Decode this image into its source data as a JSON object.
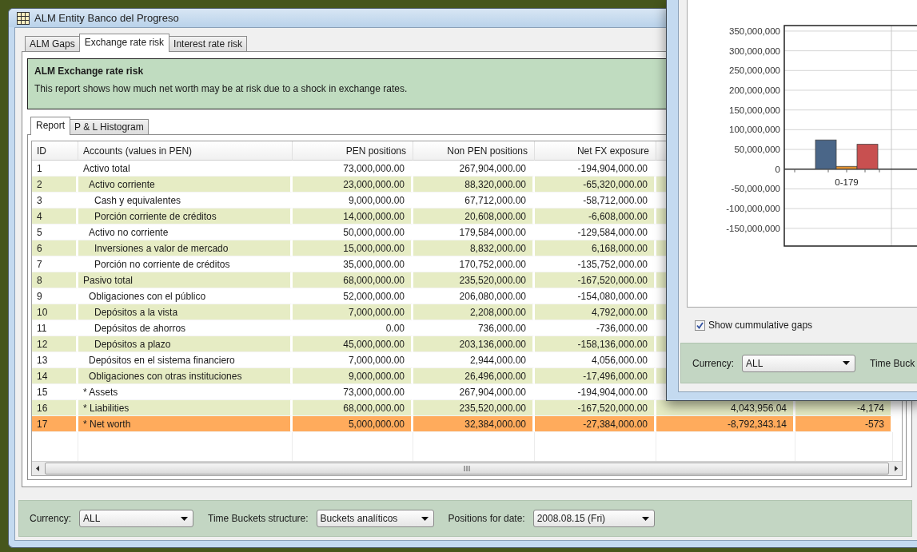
{
  "window": {
    "title": "ALM Entity Banco del Progreso"
  },
  "tabs": [
    {
      "label": "ALM Gaps",
      "selected": false
    },
    {
      "label": "Exchange rate risk",
      "selected": true
    },
    {
      "label": "Interest rate risk",
      "selected": false
    }
  ],
  "info": {
    "title": "ALM Exchange rate risk",
    "text": "This report shows how much net worth may be at risk due to a shock in exchange rates."
  },
  "sub_tabs": [
    {
      "label": "Report",
      "selected": true
    },
    {
      "label": "P & L Histogram",
      "selected": false
    }
  ],
  "table": {
    "columns": [
      "ID",
      "Accounts (values in PEN)",
      "PEN positions",
      "Non PEN positions",
      "Net FX exposure"
    ],
    "rows": [
      {
        "id": "1",
        "account": "Activo total",
        "pen": "73,000,000.00",
        "non_pen": "267,904,000.00",
        "net_fx": "-194,904,000.00",
        "highlighted": false,
        "children": [
          {
            "id": "2",
            "account": "Activo corriente",
            "pen": "23,000,000.00",
            "non_pen": "88,320,000.00",
            "net_fx": "-65,320,000.00",
            "highlighted": false,
            "children": [
              {
                "id": "3",
                "account": "Cash y equivalentes",
                "pen": "9,000,000.00",
                "non_pen": "67,712,000.00",
                "net_fx": "-58,712,000.00",
                "highlighted": false
              },
              {
                "id": "4",
                "account": "Porción corriente de créditos",
                "pen": "14,000,000.00",
                "non_pen": "20,608,000.00",
                "net_fx": "-6,608,000.00",
                "highlighted": false
              }
            ]
          },
          {
            "id": "5",
            "account": "Activo no corriente",
            "pen": "50,000,000.00",
            "non_pen": "179,584,000.00",
            "net_fx": "-129,584,000.00",
            "highlighted": false,
            "children": [
              {
                "id": "6",
                "account": "Inversiones a valor de mercado",
                "pen": "15,000,000.00",
                "non_pen": "8,832,000.00",
                "net_fx": "6,168,000.00",
                "highlighted": false
              },
              {
                "id": "7",
                "account": "Porción no corriente de créditos",
                "pen": "35,000,000.00",
                "non_pen": "170,752,000.00",
                "net_fx": "-135,752,000.00",
                "highlighted": false
              }
            ]
          }
        ]
      },
      {
        "id": "8",
        "account": "Pasivo total",
        "pen": "68,000,000.00",
        "non_pen": "235,520,000.00",
        "net_fx": "-167,520,000.00",
        "highlighted": false,
        "children": [
          {
            "id": "9",
            "account": "Obligaciones con el público",
            "pen": "52,000,000.00",
            "non_pen": "206,080,000.00",
            "net_fx": "-154,080,000.00",
            "highlighted": false,
            "children": [
              {
                "id": "10",
                "account": "Depósitos a la vista",
                "pen": "7,000,000.00",
                "non_pen": "2,208,000.00",
                "net_fx": "4,792,000.00",
                "highlighted": false
              },
              {
                "id": "11",
                "account": "Depósitos de ahorros",
                "pen": "0.00",
                "non_pen": "736,000.00",
                "net_fx": "-736,000.00",
                "highlighted": false
              },
              {
                "id": "12",
                "account": "Depósitos a plazo",
                "pen": "45,000,000.00",
                "non_pen": "203,136,000.00",
                "net_fx": "-158,136,000.00",
                "highlighted": false
              }
            ]
          },
          {
            "id": "13",
            "account": "Depósitos en el sistema financiero",
            "pen": "7,000,000.00",
            "non_pen": "2,944,000.00",
            "net_fx": "4,056,000.00",
            "highlighted": false
          },
          {
            "id": "14",
            "account": "Obligaciones con otras instituciones",
            "pen": "9,000,000.00",
            "non_pen": "26,496,000.00",
            "net_fx": "-17,496,000.00",
            "highlighted": false
          }
        ]
      },
      {
        "id": "15",
        "account": "* Assets",
        "pen": "73,000,000.00",
        "non_pen": "267,904,000.00",
        "net_fx": "-194,904,000.00",
        "highlighted": false
      },
      {
        "id": "16",
        "account": "* Liabilities",
        "pen": "68,000,000.00",
        "non_pen": "235,520,000.00",
        "net_fx": "-167,520,000.00",
        "column_6": "4,043,956.04",
        "column_7": "-4,174",
        "highlighted": false
      },
      {
        "id": "17",
        "account": "* Net worth",
        "pen": "5,000,000.00",
        "non_pen": "32,384,000.00",
        "net_fx": "-27,384,000.00",
        "column_6": "-8,792,343.14",
        "column_7": "-573",
        "highlighted": true
      }
    ]
  },
  "filters": [
    {
      "label": "Currency:",
      "value": "ALL"
    },
    {
      "label": "Time Buckets structure:",
      "value": "Buckets analíticos"
    },
    {
      "label": "Positions for date:",
      "value": "2008.08.15 (Fri)"
    }
  ],
  "gaps_window": {
    "chart_data": {
      "type": "bar",
      "grid": true,
      "categories": [
        "0-179"
      ],
      "series": [
        {
          "color": "#4a6688",
          "values": [
            74000000
          ]
        },
        {
          "color": "#e0902e",
          "values": [
            7000000
          ]
        },
        {
          "color": "#c85050",
          "values": [
            63000000
          ]
        }
      ],
      "ylim": [
        -195000000,
        364000000
      ],
      "yticks": [
        {
          "value": 350000000,
          "label": "350,000,000"
        },
        {
          "value": 300000000,
          "label": "300,000,000"
        },
        {
          "value": 250000000,
          "label": "250,000,000"
        },
        {
          "value": 200000000,
          "label": "200,000,000"
        },
        {
          "value": 150000000,
          "label": "150,000,000"
        },
        {
          "value": 100000000,
          "label": "100,000,000"
        },
        {
          "value": 50000000,
          "label": "50,000,000"
        },
        {
          "value": 0,
          "label": "0"
        },
        {
          "value": -50000000,
          "label": "-50,000,000"
        },
        {
          "value": -100000000,
          "label": "-100,000,000"
        },
        {
          "value": -150000000,
          "label": "-150,000,000"
        }
      ]
    },
    "show_cumulative": {
      "label": "Show cummulative gaps",
      "checked": true
    },
    "currency": {
      "label": "Currency:",
      "value": "ALL"
    },
    "time_buckets": {
      "label": "Time Buck"
    }
  }
}
